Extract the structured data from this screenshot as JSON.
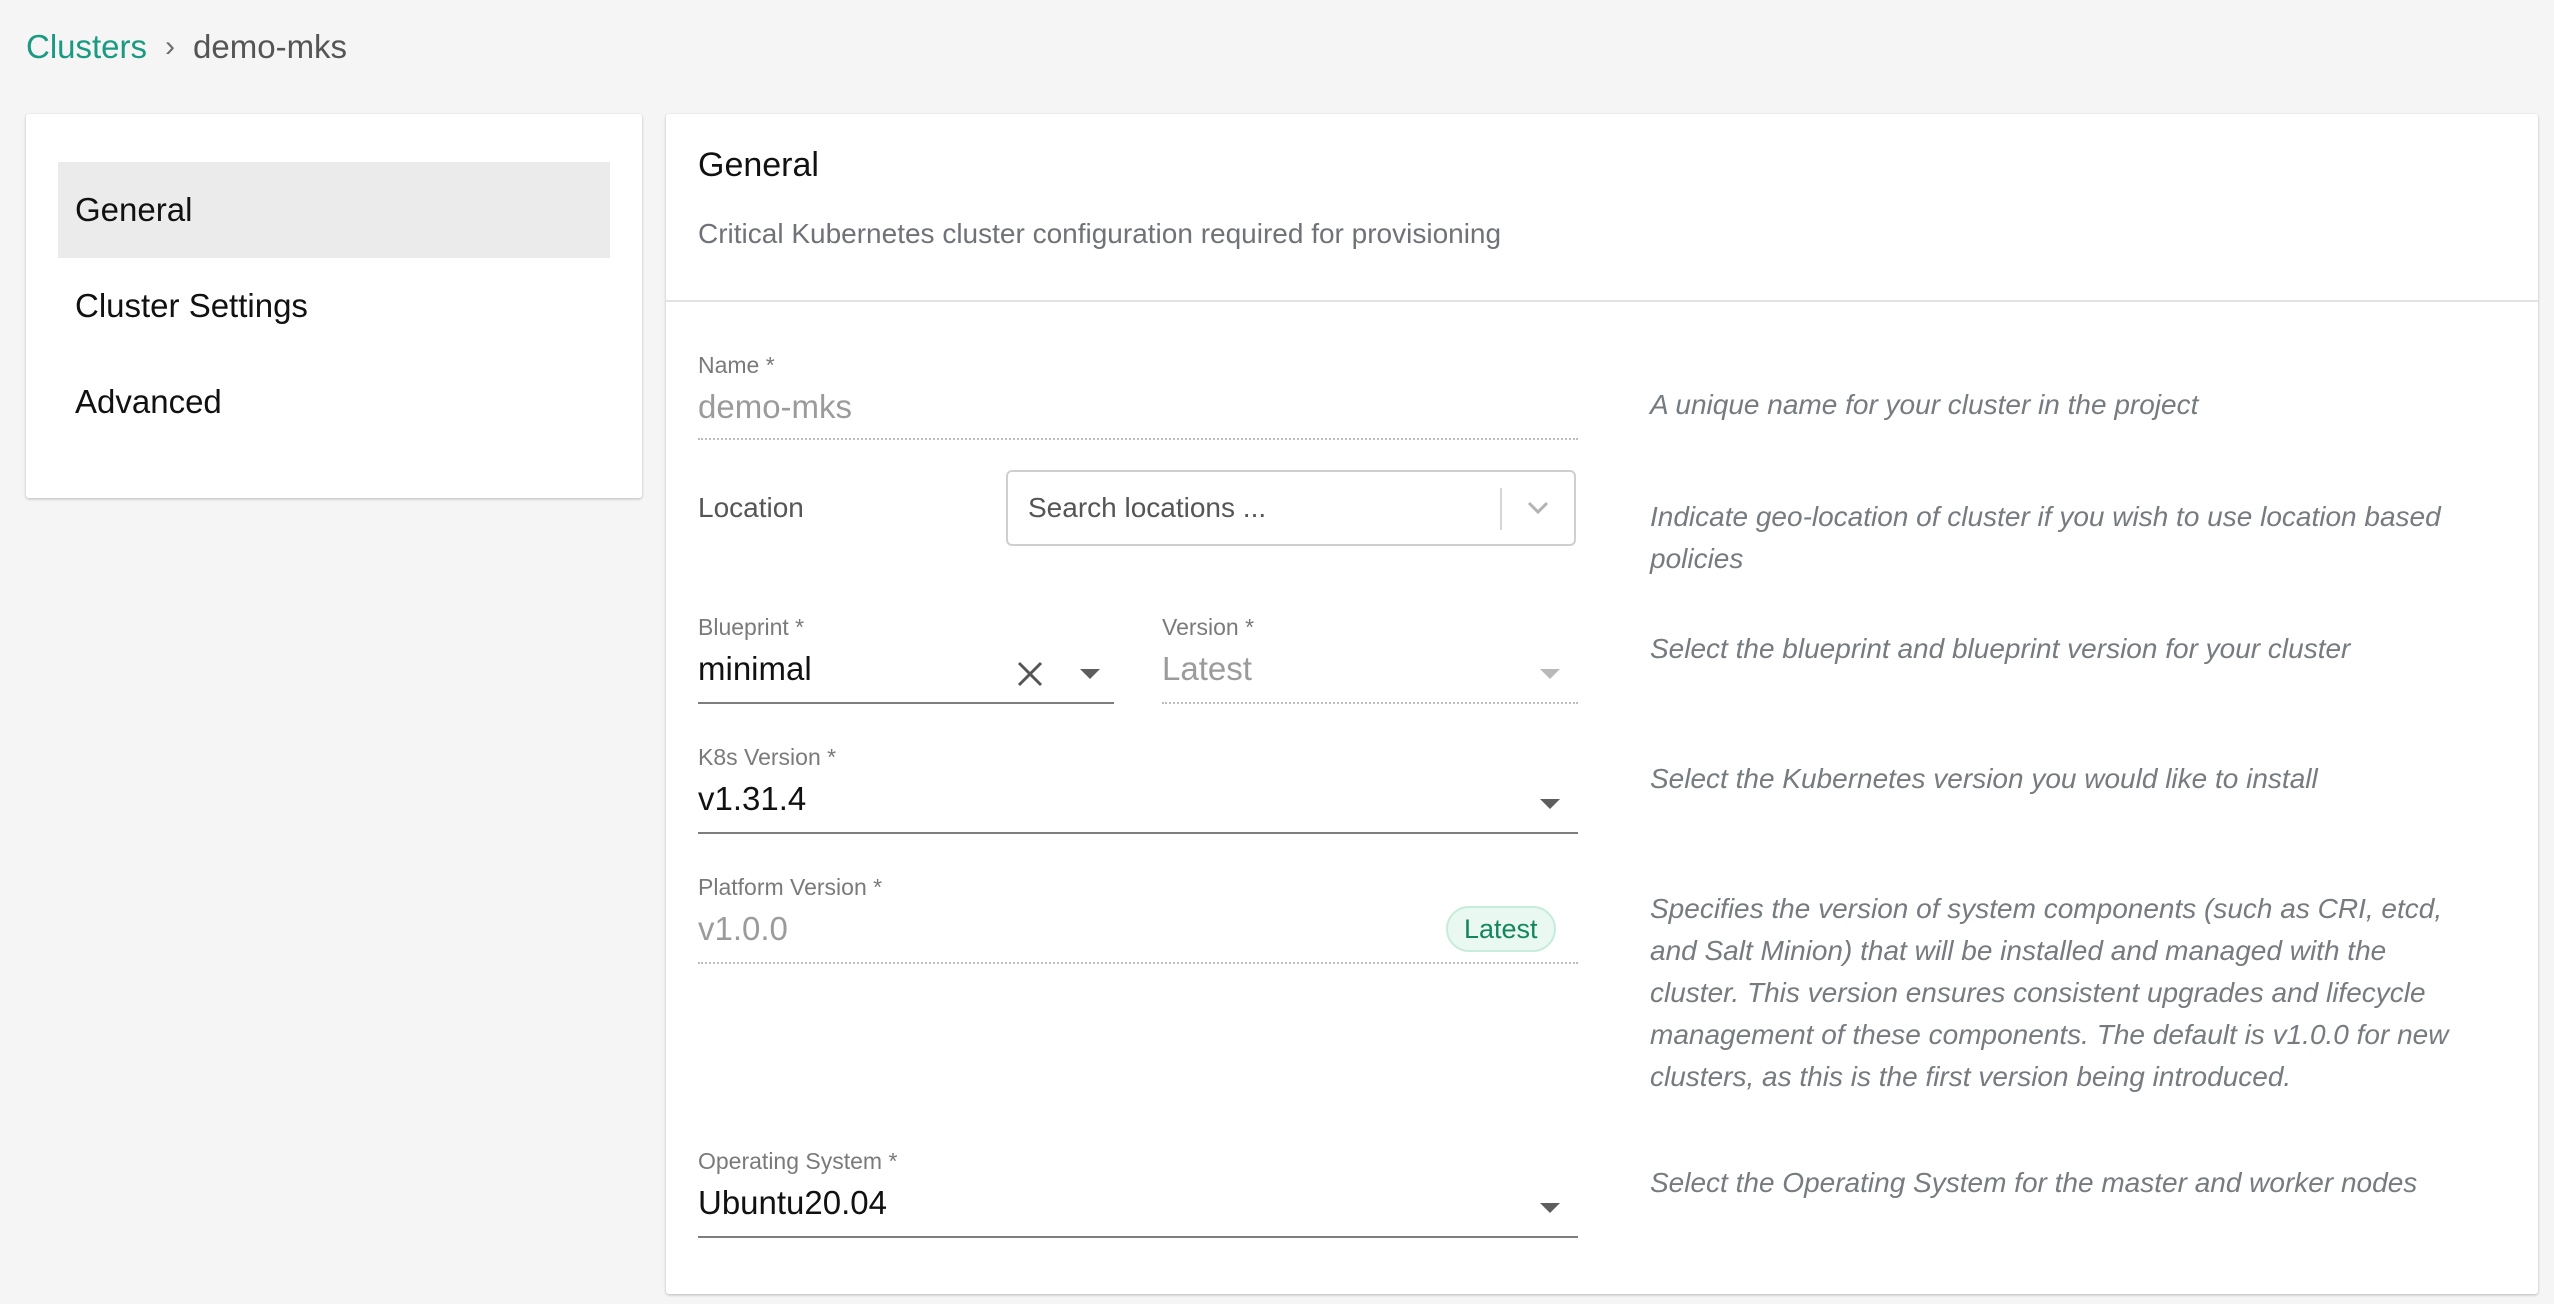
{
  "breadcrumb": {
    "link": "Clusters",
    "separator": "›",
    "current": "demo-mks"
  },
  "sidebar": {
    "items": [
      {
        "label": "General",
        "active": true
      },
      {
        "label": "Cluster Settings",
        "active": false
      },
      {
        "label": "Advanced",
        "active": false
      }
    ]
  },
  "main": {
    "title": "General",
    "subtitle": "Critical Kubernetes cluster configuration required for provisioning",
    "fields": {
      "name": {
        "label": "Name *",
        "value": "demo-mks",
        "help": "A unique name for your cluster in the project"
      },
      "location": {
        "label": "Location",
        "placeholder": "Search locations ...",
        "help": "Indicate geo-location of cluster if you wish to use location based policies"
      },
      "blueprint": {
        "label": "Blueprint *",
        "value": "minimal"
      },
      "blueprint_version": {
        "label": "Version *",
        "value": "Latest"
      },
      "blueprint_help": "Select the blueprint and blueprint version for your cluster",
      "k8s_version": {
        "label": "K8s Version *",
        "value": "v1.31.4",
        "help": "Select the Kubernetes version you would like to install"
      },
      "platform_version": {
        "label": "Platform Version *",
        "value": "v1.0.0",
        "badge": "Latest",
        "help": "Specifies the version of system components (such as CRI, etcd, and Salt Minion) that will be installed and managed with the cluster. This version ensures consistent upgrades and lifecycle management of these components. The default is v1.0.0 for new clusters, as this is the first version being introduced."
      },
      "os": {
        "label": "Operating System *",
        "value": "Ubuntu20.04",
        "help": "Select the Operating System for the master and worker nodes"
      }
    }
  },
  "colors": {
    "accent": "#1a9a82",
    "badge_bg": "#e9f8f1",
    "badge_text": "#13855f"
  },
  "icons": [
    "chevron-down-icon",
    "close-icon",
    "caret-down-icon"
  ]
}
